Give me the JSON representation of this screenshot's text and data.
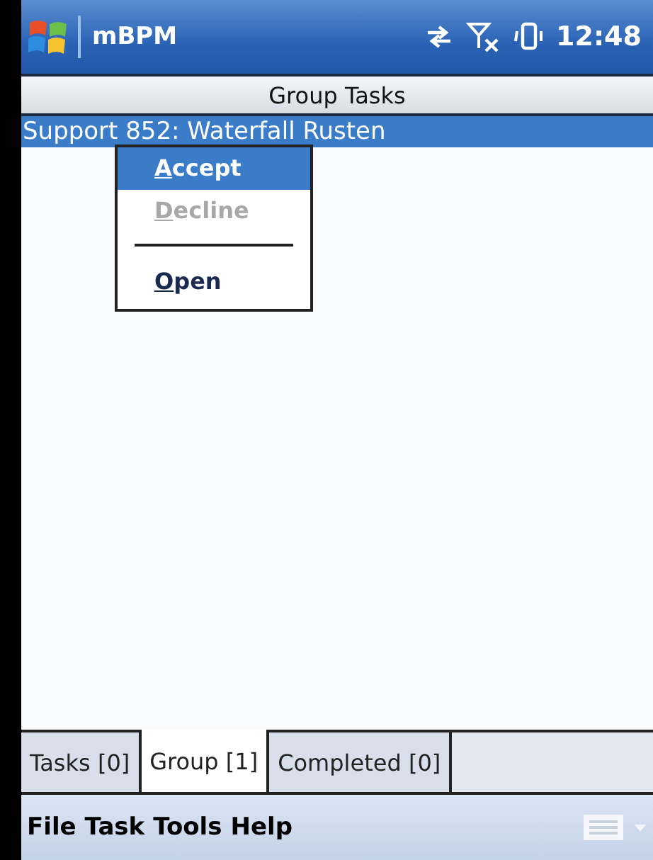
{
  "status_bar": {
    "app_name": "mBPM",
    "time": "12:48"
  },
  "header": {
    "title": "Group Tasks"
  },
  "tasks": [
    {
      "label": "Support 852: Waterfall Rusten",
      "selected": true
    }
  ],
  "context_menu": [
    {
      "kind": "item",
      "label": "Accept",
      "selected": true,
      "disabled": false
    },
    {
      "kind": "item",
      "label": "Decline",
      "selected": false,
      "disabled": true
    },
    {
      "kind": "separator"
    },
    {
      "kind": "item",
      "label": "Open",
      "selected": false,
      "disabled": false
    }
  ],
  "tabs": [
    {
      "label": "Tasks [0]",
      "selected": false
    },
    {
      "label": "Group [1]",
      "selected": true
    },
    {
      "label": "Completed [0]",
      "selected": false
    }
  ],
  "menu_bar": [
    "File",
    "Task",
    "Tools",
    "Help"
  ]
}
